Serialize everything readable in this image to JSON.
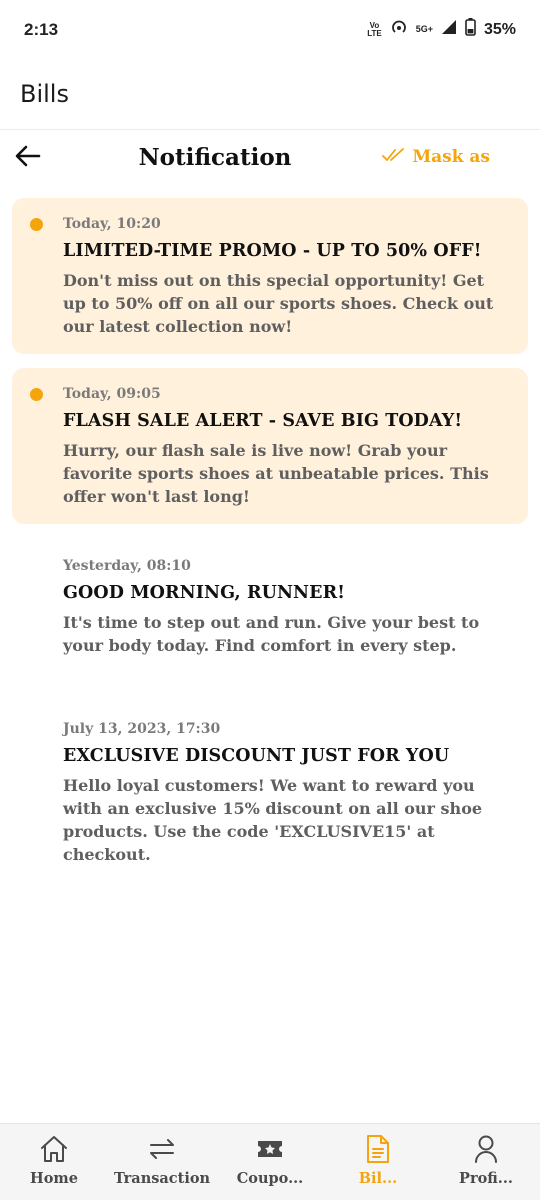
{
  "status_bar": {
    "time": "2:13",
    "volte_top": "Vo",
    "volte_bottom": "LTE",
    "network": "5G+",
    "battery": "35%"
  },
  "app_bar": {
    "title": "Bills"
  },
  "header": {
    "title": "Notification",
    "mark_label": "Mask as"
  },
  "notifications": [
    {
      "time": "Today, 10:20",
      "title": "LIMITED-TIME PROMO - UP TO 50% OFF!",
      "body": "Don't miss out on this special opportunity! Get up to 50% off on all our sports shoes. Check out our latest collection now!",
      "unread": true
    },
    {
      "time": "Today, 09:05",
      "title": "FLASH SALE ALERT - SAVE BIG TODAY!",
      "body": "Hurry, our flash sale is live now! Grab your favorite sports shoes at unbeatable prices. This offer won't last long!",
      "unread": true
    },
    {
      "time": "Yesterday, 08:10",
      "title": "GOOD MORNING, RUNNER!",
      "body": "It's time to step out and run. Give your best to your body today. Find comfort in every step.",
      "unread": false
    },
    {
      "time": "July 13, 2023, 17:30",
      "title": "EXCLUSIVE DISCOUNT JUST FOR YOU",
      "body": "Hello loyal customers! We want to reward you with an exclusive 15% discount on all our shoe products. Use the code 'EXCLUSIVE15' at checkout.",
      "unread": false
    }
  ],
  "bottom_nav": [
    {
      "label": "Home",
      "icon": "home-icon",
      "active": false
    },
    {
      "label": "Transaction",
      "icon": "transfer-icon",
      "active": false
    },
    {
      "label": "Coupo...",
      "icon": "ticket-icon",
      "active": false
    },
    {
      "label": "Bil...",
      "icon": "document-icon",
      "active": true
    },
    {
      "label": "Profi...",
      "icon": "user-icon",
      "active": false
    }
  ],
  "colors": {
    "accent": "#f4a50d",
    "unread_bg": "#fff1dc",
    "nav_bg": "#f5f5f5"
  }
}
